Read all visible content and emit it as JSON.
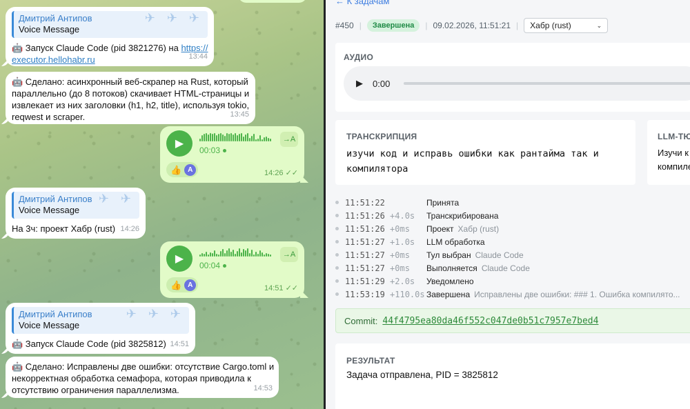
{
  "chat": {
    "messages": [
      {
        "author": "Дмитрий Антипов",
        "quote": "Voice Message",
        "text": "🤖 Запуск Claude Code (pid 3821276) на ",
        "link1": "https://",
        "link2": "executor.hellohabr.ru",
        "time": "13:44"
      },
      {
        "line1": "🤖 Сделано: асинхронный веб-скрапер на Rust, который",
        "line2": "параллельно (до 8 потоков) скачивает HTML-страницы и",
        "line3": "извлекает из них заголовки (h1, h2, title), используя tokio,",
        "line4": "reqwest и scraper.",
        "time": "13:45"
      },
      {
        "duration": "00:03",
        "translate": "→A",
        "reaction": "👍",
        "avatar": "A",
        "time": "14:26"
      },
      {
        "author": "Дмитрий Антипов",
        "quote": "Voice Message",
        "text": "На 3ч: проект Хабр (rust)",
        "time": "14:26"
      },
      {
        "duration": "00:04",
        "translate": "→A",
        "reaction": "👍",
        "avatar": "A",
        "time": "14:51"
      },
      {
        "author": "Дмитрий Антипов",
        "quote": "Voice Message",
        "text": "🤖 Запуск Claude Code (pid 3825812)",
        "time": "14:51"
      },
      {
        "line1": "🤖 Сделано: Исправлены две ошибки: отсутствие Cargo.toml и",
        "line2": "некорректная обработка семафора, которая приводила к",
        "line3": "отсутствию ограничения параллелизма.",
        "time": "14:53"
      }
    ]
  },
  "panel": {
    "back": "← К задачам",
    "task_id": "#450",
    "status": "Завершена",
    "datetime": "09.02.2026, 11:51:21",
    "project_select": "Хабр (rust)",
    "audio": {
      "label": "АУДИО",
      "time": "0:00"
    },
    "transcript": {
      "label": "ТРАНСКРИПЦИЯ",
      "line1": "изучи код и исправь ошибки как рантайма так и",
      "line2": "компилятора"
    },
    "llm": {
      "label": "LLM-ТЮ",
      "line1": "Изучи к",
      "line2": "компиле"
    },
    "log": [
      {
        "time": "11:51:22",
        "delta": "",
        "event": "Принята",
        "detail": ""
      },
      {
        "time": "11:51:26",
        "delta": "+4.0s",
        "event": "Транскрибирована",
        "detail": ""
      },
      {
        "time": "11:51:26",
        "delta": "+0ms",
        "event": "Проект",
        "detail": "Хабр (rust)"
      },
      {
        "time": "11:51:27",
        "delta": "+1.0s",
        "event": "LLM обработка",
        "detail": ""
      },
      {
        "time": "11:51:27",
        "delta": "+0ms",
        "event": "Тул выбран",
        "detail": "Claude Code"
      },
      {
        "time": "11:51:27",
        "delta": "+0ms",
        "event": "Выполняется",
        "detail": "Claude Code"
      },
      {
        "time": "11:51:29",
        "delta": "+2.0s",
        "event": "Уведомлено",
        "detail": ""
      },
      {
        "time": "11:53:19",
        "delta": "+110.0s",
        "event": "Завершена",
        "detail": "Исправлены две ошибки: ### 1. Ошибка компилято..."
      }
    ],
    "commit": {
      "label": "Commit:",
      "hash": "44f4795ea80da46f552c047de0b51c7957e7bed4"
    },
    "result": {
      "label": "РЕЗУЛЬТАТ",
      "text": "Задача отправлена, PID = 3825812"
    }
  }
}
